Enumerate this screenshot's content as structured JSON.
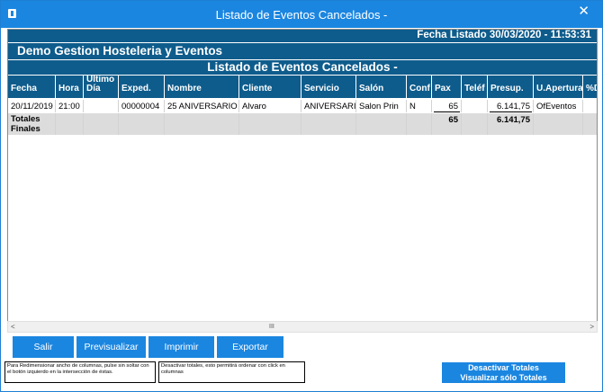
{
  "window": {
    "title": "Listado de Eventos Cancelados     -",
    "close": "✕"
  },
  "report": {
    "date_line": "Fecha Listado   30/03/2020 - 11:53:31",
    "company": "Demo Gestion Hosteleria y Eventos",
    "title": "Listado de Eventos Cancelados     -"
  },
  "table": {
    "headers": [
      "Fecha",
      "Hora",
      "Último Día",
      "Exped.",
      "Nombre",
      "Cliente",
      "Servicio",
      "Salón",
      "Conf",
      "Pax",
      "Teléf",
      "Presup.",
      "U.Apertura",
      "%D"
    ],
    "rows": [
      [
        "20/11/2019",
        "21:00",
        "",
        "00000004",
        "25 ANIVERSARIO",
        "Alvaro",
        "ANIVERSARI",
        "Salon Prin",
        "N",
        "65",
        "",
        "6.141,75",
        "OfEventos",
        ""
      ]
    ],
    "totals": {
      "label_line1": "Totales",
      "label_line2": "Finales",
      "pax": "65",
      "presup": "6.141,75"
    }
  },
  "scrollbar": {
    "left": "<",
    "thumb": "III",
    "right": ">"
  },
  "buttons": {
    "salir": "Salir",
    "previsualizar": "Previsualizar",
    "imprimir": "Imprimir",
    "exportar": "Exportar"
  },
  "notes": {
    "resize": "Para Redimensionar ancho de columnas, pulse sin soltar con el botón izquierdo en la intersección de éstas.",
    "totals": "Desactivar totales, esto permitirá ordenar con click en columnas"
  },
  "totals_button": {
    "line1": "Desactivar Totales",
    "line2": "Visualizar sólo Totales"
  }
}
